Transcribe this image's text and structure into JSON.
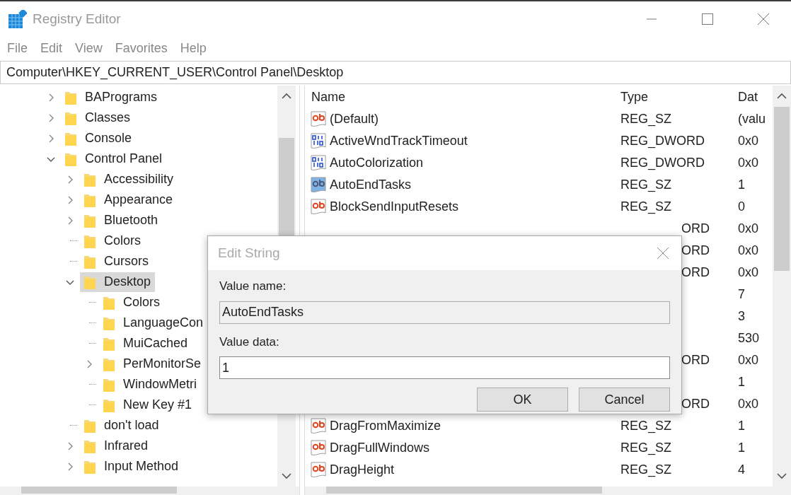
{
  "window": {
    "title": "Registry Editor"
  },
  "menu": [
    "File",
    "Edit",
    "View",
    "Favorites",
    "Help"
  ],
  "address": "Computer\\HKEY_CURRENT_USER\\Control Panel\\Desktop",
  "tree": [
    {
      "label": "BAPrograms",
      "expanded": false,
      "selected": false
    },
    {
      "label": "Classes",
      "expanded": false,
      "selected": false
    },
    {
      "label": "Console",
      "expanded": false,
      "selected": false
    },
    {
      "label": "Control Panel",
      "expanded": true,
      "selected": false,
      "children": [
        {
          "label": "Accessibility",
          "expanded": false,
          "selected": false
        },
        {
          "label": "Appearance",
          "expanded": false,
          "selected": false
        },
        {
          "label": "Bluetooth",
          "expanded": false,
          "selected": false
        },
        {
          "label": "Colors",
          "selected": false
        },
        {
          "label": "Cursors",
          "selected": false
        },
        {
          "label": "Desktop",
          "expanded": true,
          "selected": true,
          "children": [
            {
              "label": "Colors",
              "selected": false
            },
            {
              "label": "LanguageCon",
              "selected": false
            },
            {
              "label": "MuiCached",
              "selected": false
            },
            {
              "label": "PerMonitorSe",
              "expanded": false,
              "selected": false
            },
            {
              "label": "WindowMetri",
              "selected": false
            },
            {
              "label": "New Key #1",
              "selected": false
            }
          ]
        },
        {
          "label": "don't load",
          "selected": false
        },
        {
          "label": "Infrared",
          "expanded": false,
          "selected": false
        },
        {
          "label": "Input Method",
          "expanded": false,
          "selected": false
        }
      ]
    }
  ],
  "table": {
    "columns": [
      "Name",
      "Type",
      "Dat"
    ],
    "rows": [
      {
        "kind": "string",
        "name": "(Default)",
        "type": "REG_SZ",
        "data": "(valu",
        "selected": false
      },
      {
        "kind": "dword",
        "name": "ActiveWndTrackTimeout",
        "type": "REG_DWORD",
        "data": "0x0",
        "selected": false
      },
      {
        "kind": "dword",
        "name": "AutoColorization",
        "type": "REG_DWORD",
        "data": "0x0",
        "selected": false
      },
      {
        "kind": "string",
        "name": "AutoEndTasks",
        "type": "REG_SZ",
        "data": "1",
        "selected": true
      },
      {
        "kind": "string",
        "name": "BlockSendInputResets",
        "type": "REG_SZ",
        "data": "0",
        "selected": false
      },
      {
        "kind": "covered",
        "type": "ORD",
        "data": "0x0"
      },
      {
        "kind": "covered",
        "type": "ORD",
        "data": "0x0"
      },
      {
        "kind": "covered",
        "type": "ORD",
        "data": "0x0"
      },
      {
        "kind": "covered",
        "data": "7"
      },
      {
        "kind": "covered",
        "data": "3"
      },
      {
        "kind": "covered",
        "data": "530"
      },
      {
        "kind": "covered",
        "type": "ORD",
        "data": "0x0"
      },
      {
        "kind": "covered",
        "data": "1"
      },
      {
        "kind": "covered",
        "type": "ORD",
        "data": "0x0"
      },
      {
        "kind": "string",
        "name": "DragFromMaximize",
        "type": "REG_SZ",
        "data": "1",
        "selected": false
      },
      {
        "kind": "string",
        "name": "DragFullWindows",
        "type": "REG_SZ",
        "data": "1",
        "selected": false
      },
      {
        "kind": "string",
        "name": "DragHeight",
        "type": "REG_SZ",
        "data": "4",
        "selected": false
      }
    ]
  },
  "dialog": {
    "title": "Edit String",
    "name_label": "Value name:",
    "name_value": "AutoEndTasks",
    "data_label": "Value data:",
    "data_value": "1",
    "buttons": [
      "OK",
      "Cancel"
    ]
  }
}
